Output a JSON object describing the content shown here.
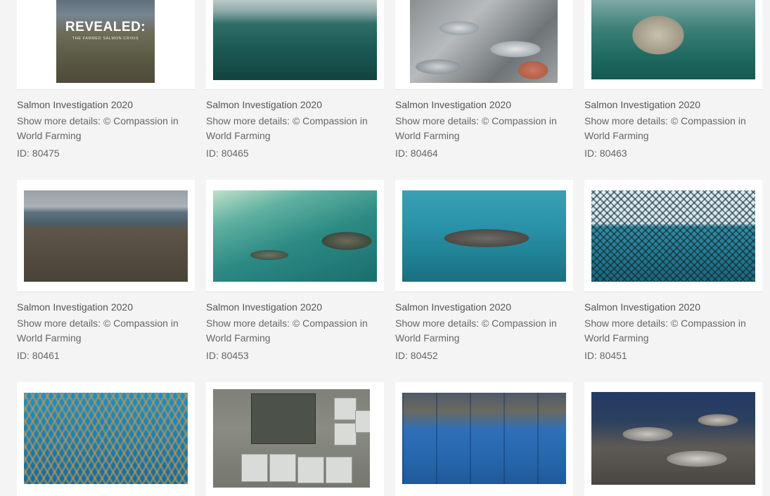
{
  "gallery": {
    "items": [
      {
        "title": "Salmon Investigation 2020",
        "details": "Show more details: © Compassion in World Farming",
        "id_label": "ID: 80475",
        "image": "poster",
        "poster_heading": "REVEALED:",
        "poster_subheading": "THE FARMED SALMON CRISIS"
      },
      {
        "title": "Salmon Investigation 2020",
        "details": "Show more details: © Compassion in World Farming",
        "id_label": "ID: 80465",
        "image": "underwater-surface"
      },
      {
        "title": "Salmon Investigation 2020",
        "details": "Show more details: © Compassion in World Farming",
        "id_label": "ID: 80464",
        "image": "fish-pile"
      },
      {
        "title": "Salmon Investigation 2020",
        "details": "Show more details: © Compassion in World Farming",
        "id_label": "ID: 80463",
        "image": "lumpfish"
      },
      {
        "title": "Salmon Investigation 2020",
        "details": "Show more details: © Compassion in World Farming",
        "id_label": "ID: 80461",
        "image": "cliff"
      },
      {
        "title": "Salmon Investigation 2020",
        "details": "Show more details: © Compassion in World Farming",
        "id_label": "ID: 80453",
        "image": "two-salmon"
      },
      {
        "title": "Salmon Investigation 2020",
        "details": "Show more details: © Compassion in World Farming",
        "id_label": "ID: 80452",
        "image": "blue-salmon"
      },
      {
        "title": "Salmon Investigation 2020",
        "details": "Show more details: © Compassion in World Farming",
        "id_label": "ID: 80451",
        "image": "net-salmon"
      },
      {
        "image": "net-salmon-2"
      },
      {
        "image": "bins-aerial"
      },
      {
        "image": "blue-boxes"
      },
      {
        "image": "dark-fish"
      }
    ]
  },
  "colors": {
    "page_background": "#f4f4f4",
    "card_background": "#ffffff",
    "title_text": "#555555",
    "body_text": "#666666"
  }
}
